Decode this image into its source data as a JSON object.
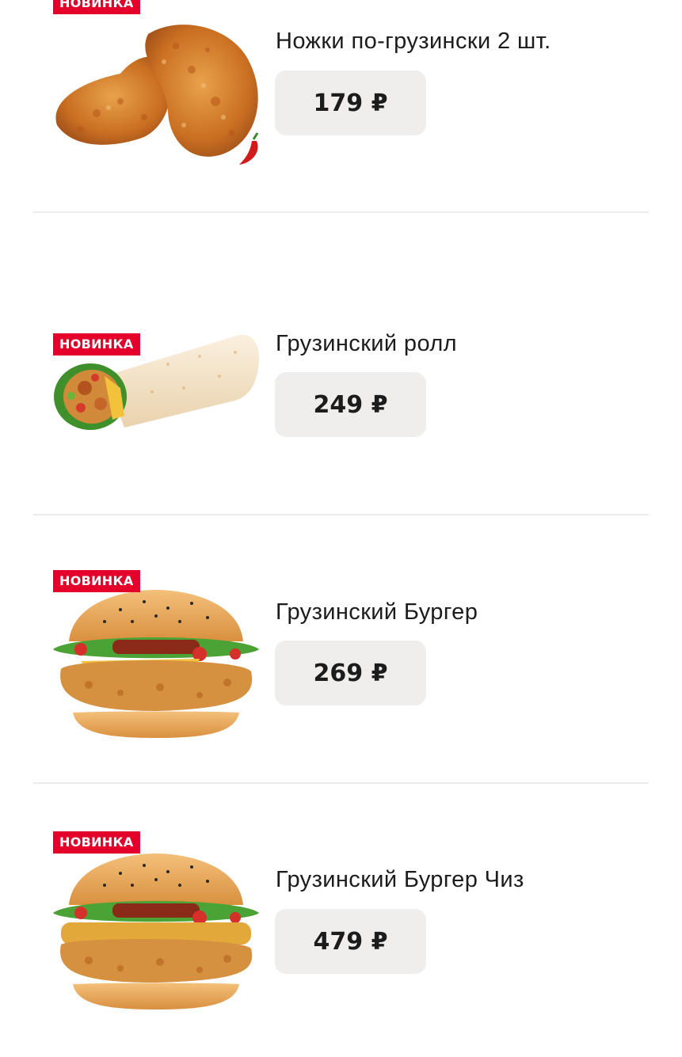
{
  "menu": {
    "items": [
      {
        "badge": "НОВИНКА",
        "title": "Ножки по-грузински 2 шт.",
        "price": "179 ₽",
        "image_icon": "chicken-drumsticks"
      },
      {
        "badge": "НОВИНКА",
        "title": "Грузинский ролл",
        "price": "249 ₽",
        "image_icon": "wrap-roll"
      },
      {
        "badge": "НОВИНКА",
        "title": "Грузинский Бургер",
        "price": "269 ₽",
        "image_icon": "chicken-burger"
      },
      {
        "badge": "НОВИНКА",
        "title": "Грузинский Бургер Чиз",
        "price": "479 ₽",
        "image_icon": "chicken-cheeseburger"
      }
    ]
  },
  "colors": {
    "badge_bg": "#e4002b",
    "price_button_bg": "#efeeed",
    "divider": "#ececec",
    "text": "#1c1c1c"
  }
}
